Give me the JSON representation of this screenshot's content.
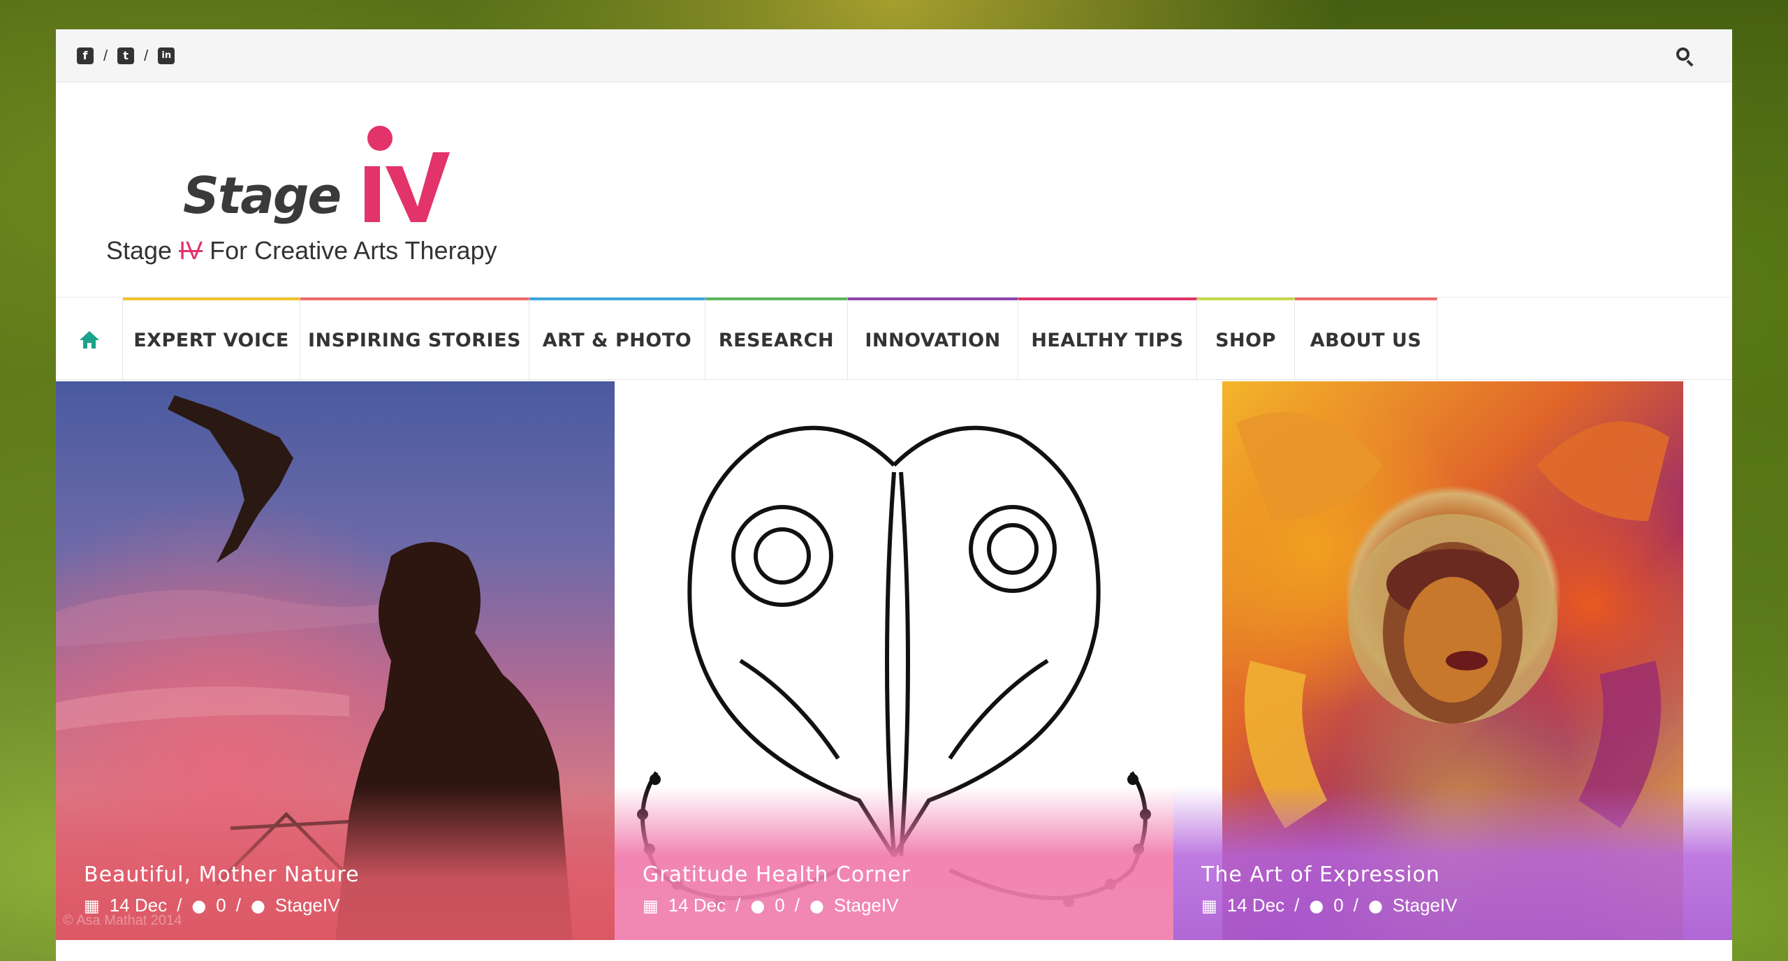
{
  "social": {
    "facebook": "f",
    "twitter": "t",
    "linkedin": "in",
    "sep": "/"
  },
  "logo": {
    "wordmark": "Stage",
    "roman": "IV",
    "tagline_pre": "Stage ",
    "tagline_strike": "IV",
    "tagline_post": " For Creative Arts Therapy",
    "accent": "#e2336b"
  },
  "nav": {
    "items": [
      {
        "label": "EXPERT VOICE",
        "color": "#f2c12e"
      },
      {
        "label": "INSPIRING STORIES",
        "color": "#ef6a6a"
      },
      {
        "label": "ART & PHOTO",
        "color": "#3aa6df"
      },
      {
        "label": "RESEARCH",
        "color": "#5cb85c"
      },
      {
        "label": "INNOVATION",
        "color": "#8e44ad"
      },
      {
        "label": "HEALTHY TIPS",
        "color": "#e2336b"
      },
      {
        "label": "SHOP",
        "color": "#c6d94a"
      },
      {
        "label": "ABOUT US",
        "color": "#ef6a6a"
      }
    ],
    "accent": "#1aa38a"
  },
  "featured": [
    {
      "title": "Beautiful, Mother Nature",
      "date": "14 Dec",
      "comments": "0",
      "author": "StageIV",
      "watermark": "© Asa Mathat 2014"
    },
    {
      "title": "Gratitude Health Corner",
      "date": "14 Dec",
      "comments": "0",
      "author": "StageIV"
    },
    {
      "title": "The Art of Expression",
      "date": "14 Dec",
      "comments": "0",
      "author": "StageIV"
    }
  ],
  "meta_sep": "/"
}
